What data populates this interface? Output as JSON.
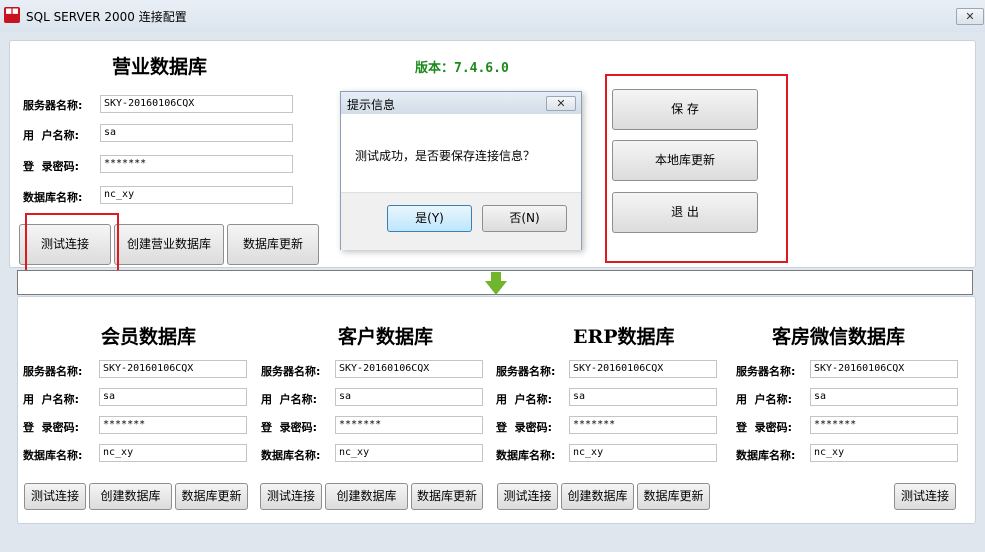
{
  "window": {
    "title": "SQL SERVER 2000 连接配置",
    "icon_text": "■■"
  },
  "version": {
    "label": "版本：7.4.6.0"
  },
  "labels": {
    "server": "服务器名称:",
    "user": "用  户名称:",
    "password": "登  录密码:",
    "database": "数据库名称:"
  },
  "main_db": {
    "title": "营业数据库",
    "server": "SKY-20160106CQX",
    "user": "sa",
    "password": "*******",
    "database": "nc_xy",
    "buttons": {
      "test": "测试连接",
      "create": "创建营业数据库",
      "update": "数据库更新"
    }
  },
  "actions": {
    "save": "保  存",
    "local_update": "本地库更新",
    "exit": "退  出"
  },
  "dialog": {
    "title": "提示信息",
    "message": "测试成功，是否要保存连接信息？",
    "yes": "是(Y)",
    "no": "否(N)"
  },
  "sub_dbs": [
    {
      "title": "会员数据库",
      "server": "SKY-20160106CQX",
      "user": "sa",
      "password": "*******",
      "database": "nc_xy",
      "test": "测试连接",
      "create": "创建数据库",
      "update": "数据库更新"
    },
    {
      "title": "客户数据库",
      "server": "SKY-20160106CQX",
      "user": "sa",
      "password": "*******",
      "database": "nc_xy",
      "test": "测试连接",
      "create": "创建数据库",
      "update": "数据库更新"
    },
    {
      "title": "ERP数据库",
      "server": "SKY-20160106CQX",
      "user": "sa",
      "password": "*******",
      "database": "nc_xy",
      "test": "测试连接",
      "create": "创建数据库",
      "update": "数据库更新"
    },
    {
      "title": "客房微信数据库",
      "server": "SKY-20160106CQX",
      "user": "sa",
      "password": "*******",
      "database": "nc_xy",
      "test": "测试连接"
    }
  ],
  "colors": {
    "highlight": "#e0191f",
    "version": "#1a8a1a",
    "arrow": "#6fb62c"
  }
}
